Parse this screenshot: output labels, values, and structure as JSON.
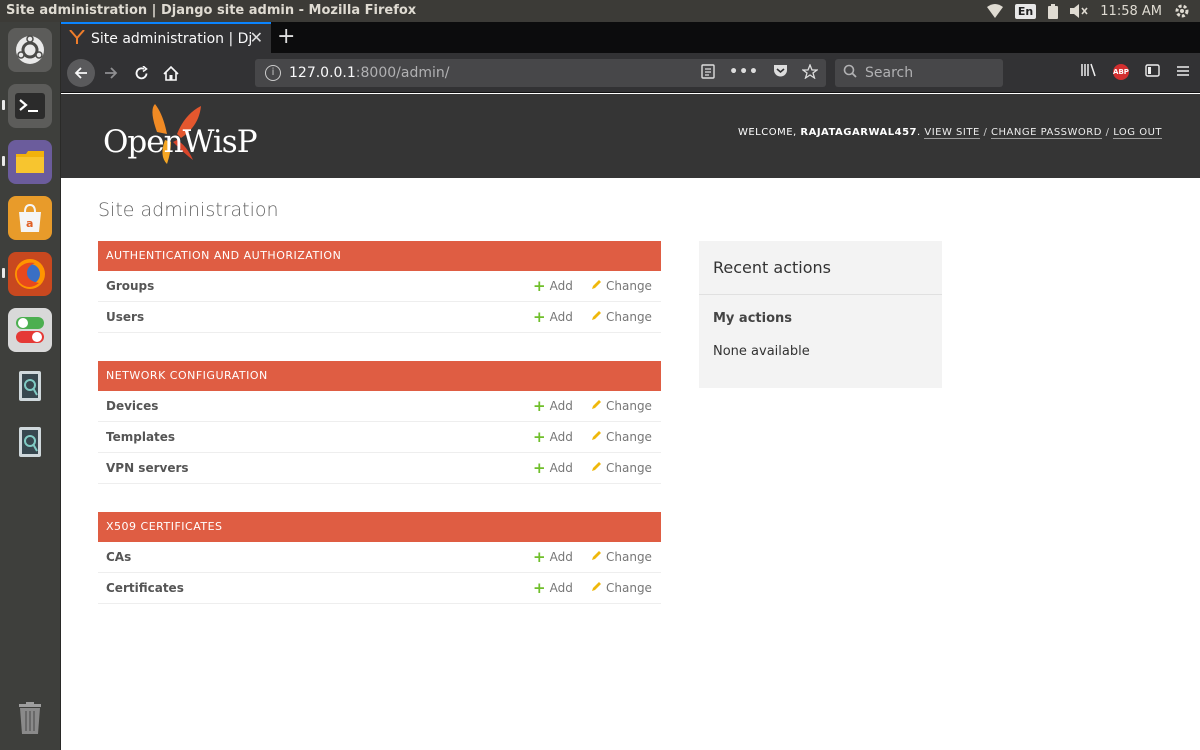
{
  "os": {
    "window_title": "Site administration | Django site admin - Mozilla Firefox",
    "keyboard_layout": "En",
    "clock": "11:58 AM"
  },
  "browser": {
    "tab_title": "Site administration | Dja",
    "url_host": "127.0.0.1",
    "url_path": ":8000/admin/",
    "search_placeholder": "Search",
    "abp_label": "ABP"
  },
  "header": {
    "logo_text": "OpenWisP",
    "welcome": "Welcome,",
    "username": "rajatagarwal457",
    "view_site": "View site",
    "change_password": "Change password",
    "log_out": "Log out",
    "separator": "/"
  },
  "page_title": "Site administration",
  "modules": [
    {
      "caption": "Authentication and Authorization",
      "rows": [
        {
          "name": "Groups",
          "add": "Add",
          "change": "Change"
        },
        {
          "name": "Users",
          "add": "Add",
          "change": "Change"
        }
      ]
    },
    {
      "caption": "Network Configuration",
      "rows": [
        {
          "name": "Devices",
          "add": "Add",
          "change": "Change"
        },
        {
          "name": "Templates",
          "add": "Add",
          "change": "Change"
        },
        {
          "name": "VPN servers",
          "add": "Add",
          "change": "Change"
        }
      ]
    },
    {
      "caption": "X509 Certificates",
      "rows": [
        {
          "name": "CAs",
          "add": "Add",
          "change": "Change"
        },
        {
          "name": "Certificates",
          "add": "Add",
          "change": "Change"
        }
      ]
    }
  ],
  "recent_actions": {
    "title": "Recent actions",
    "my_actions": "My actions",
    "none": "None available"
  },
  "colors": {
    "caption_bg": "#df5d43",
    "header_bg": "#353535",
    "add_icon": "#70bf2b",
    "change_icon": "#efb80b",
    "tab_accent": "#0a84ff"
  },
  "icons": {
    "launcher": [
      "ubuntu-logo-icon",
      "terminal-icon",
      "files-icon",
      "software-center-icon",
      "firefox-icon",
      "settings-toggle-icon",
      "app-icon",
      "app-icon",
      "trash-icon"
    ]
  }
}
